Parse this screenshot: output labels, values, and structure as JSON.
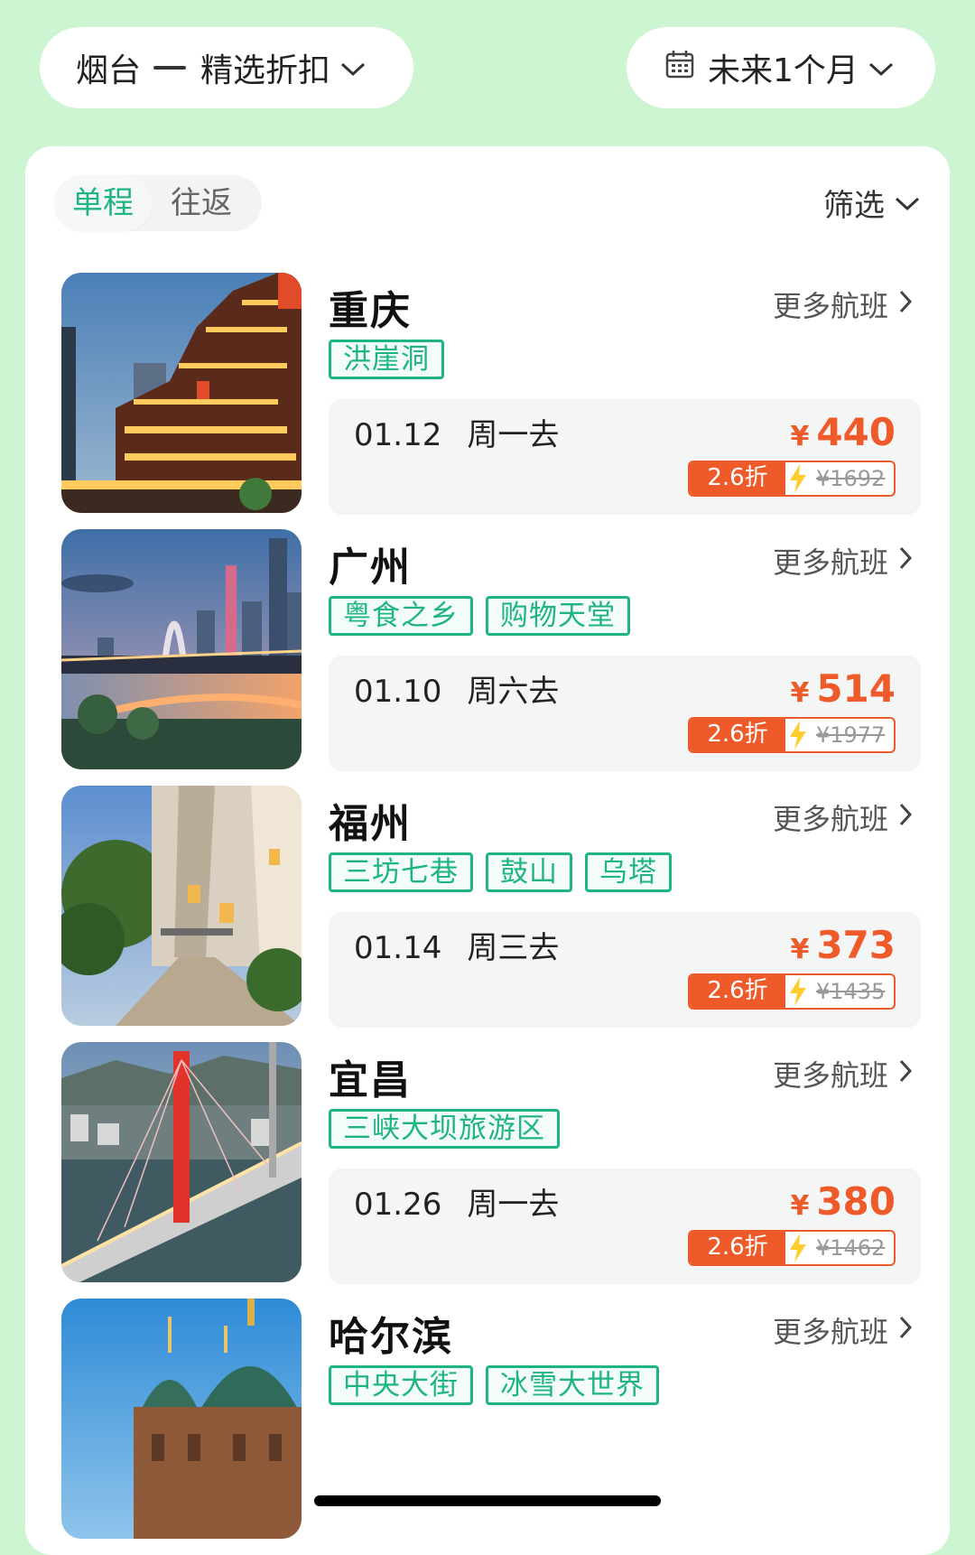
{
  "header": {
    "origin": "烟台",
    "route_filter": "精选折扣",
    "date_range": "未来1个月"
  },
  "tabs": [
    {
      "label": "单程",
      "active": true
    },
    {
      "label": "往返",
      "active": false
    }
  ],
  "filter_label": "筛选",
  "more_flights_label": "更多航班",
  "colors": {
    "accent": "#1fb486",
    "price": "#ef5a2a",
    "background": "#cdf5d2"
  },
  "destinations": [
    {
      "name": "重庆",
      "tags": [
        "洪崖洞"
      ],
      "date": "01.12",
      "weekday": "周一去",
      "currency": "¥",
      "price": "440",
      "discount": "2.6折",
      "original_price": "¥1692"
    },
    {
      "name": "广州",
      "tags": [
        "粤食之乡",
        "购物天堂"
      ],
      "date": "01.10",
      "weekday": "周六去",
      "currency": "¥",
      "price": "514",
      "discount": "2.6折",
      "original_price": "¥1977"
    },
    {
      "name": "福州",
      "tags": [
        "三坊七巷",
        "鼓山",
        "乌塔"
      ],
      "date": "01.14",
      "weekday": "周三去",
      "currency": "¥",
      "price": "373",
      "discount": "2.6折",
      "original_price": "¥1435"
    },
    {
      "name": "宜昌",
      "tags": [
        "三峡大坝旅游区"
      ],
      "date": "01.26",
      "weekday": "周一去",
      "currency": "¥",
      "price": "380",
      "discount": "2.6折",
      "original_price": "¥1462"
    },
    {
      "name": "哈尔滨",
      "tags": [
        "中央大街",
        "冰雪大世界"
      ]
    }
  ]
}
